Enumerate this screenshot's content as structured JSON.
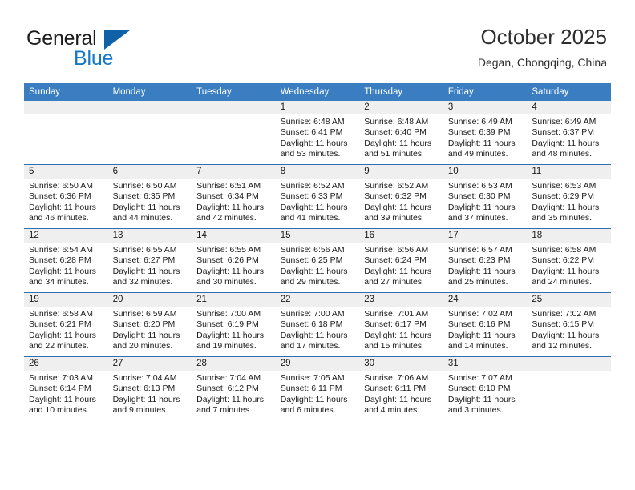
{
  "brand": {
    "line1": "General",
    "line2": "Blue",
    "triangle_color": "#1161a9",
    "blue_text_color": "#1678c8"
  },
  "header": {
    "title": "October 2025",
    "subtitle": "Degan, Chongqing, China"
  },
  "theme": {
    "header_row_bg": "#3a7dc0",
    "date_band_bg": "#efefef",
    "row_separator": "#2f6fb0",
    "text": "#1a1a1a"
  },
  "weekdays": [
    "Sunday",
    "Monday",
    "Tuesday",
    "Wednesday",
    "Thursday",
    "Friday",
    "Saturday"
  ],
  "weeks": [
    [
      {
        "blank": true
      },
      {
        "blank": true
      },
      {
        "blank": true
      },
      {
        "date": "1",
        "sunrise": "Sunrise: 6:48 AM",
        "sunset": "Sunset: 6:41 PM",
        "daylight1": "Daylight: 11 hours",
        "daylight2": "and 53 minutes."
      },
      {
        "date": "2",
        "sunrise": "Sunrise: 6:48 AM",
        "sunset": "Sunset: 6:40 PM",
        "daylight1": "Daylight: 11 hours",
        "daylight2": "and 51 minutes."
      },
      {
        "date": "3",
        "sunrise": "Sunrise: 6:49 AM",
        "sunset": "Sunset: 6:39 PM",
        "daylight1": "Daylight: 11 hours",
        "daylight2": "and 49 minutes."
      },
      {
        "date": "4",
        "sunrise": "Sunrise: 6:49 AM",
        "sunset": "Sunset: 6:37 PM",
        "daylight1": "Daylight: 11 hours",
        "daylight2": "and 48 minutes."
      }
    ],
    [
      {
        "date": "5",
        "sunrise": "Sunrise: 6:50 AM",
        "sunset": "Sunset: 6:36 PM",
        "daylight1": "Daylight: 11 hours",
        "daylight2": "and 46 minutes."
      },
      {
        "date": "6",
        "sunrise": "Sunrise: 6:50 AM",
        "sunset": "Sunset: 6:35 PM",
        "daylight1": "Daylight: 11 hours",
        "daylight2": "and 44 minutes."
      },
      {
        "date": "7",
        "sunrise": "Sunrise: 6:51 AM",
        "sunset": "Sunset: 6:34 PM",
        "daylight1": "Daylight: 11 hours",
        "daylight2": "and 42 minutes."
      },
      {
        "date": "8",
        "sunrise": "Sunrise: 6:52 AM",
        "sunset": "Sunset: 6:33 PM",
        "daylight1": "Daylight: 11 hours",
        "daylight2": "and 41 minutes."
      },
      {
        "date": "9",
        "sunrise": "Sunrise: 6:52 AM",
        "sunset": "Sunset: 6:32 PM",
        "daylight1": "Daylight: 11 hours",
        "daylight2": "and 39 minutes."
      },
      {
        "date": "10",
        "sunrise": "Sunrise: 6:53 AM",
        "sunset": "Sunset: 6:30 PM",
        "daylight1": "Daylight: 11 hours",
        "daylight2": "and 37 minutes."
      },
      {
        "date": "11",
        "sunrise": "Sunrise: 6:53 AM",
        "sunset": "Sunset: 6:29 PM",
        "daylight1": "Daylight: 11 hours",
        "daylight2": "and 35 minutes."
      }
    ],
    [
      {
        "date": "12",
        "sunrise": "Sunrise: 6:54 AM",
        "sunset": "Sunset: 6:28 PM",
        "daylight1": "Daylight: 11 hours",
        "daylight2": "and 34 minutes."
      },
      {
        "date": "13",
        "sunrise": "Sunrise: 6:55 AM",
        "sunset": "Sunset: 6:27 PM",
        "daylight1": "Daylight: 11 hours",
        "daylight2": "and 32 minutes."
      },
      {
        "date": "14",
        "sunrise": "Sunrise: 6:55 AM",
        "sunset": "Sunset: 6:26 PM",
        "daylight1": "Daylight: 11 hours",
        "daylight2": "and 30 minutes."
      },
      {
        "date": "15",
        "sunrise": "Sunrise: 6:56 AM",
        "sunset": "Sunset: 6:25 PM",
        "daylight1": "Daylight: 11 hours",
        "daylight2": "and 29 minutes."
      },
      {
        "date": "16",
        "sunrise": "Sunrise: 6:56 AM",
        "sunset": "Sunset: 6:24 PM",
        "daylight1": "Daylight: 11 hours",
        "daylight2": "and 27 minutes."
      },
      {
        "date": "17",
        "sunrise": "Sunrise: 6:57 AM",
        "sunset": "Sunset: 6:23 PM",
        "daylight1": "Daylight: 11 hours",
        "daylight2": "and 25 minutes."
      },
      {
        "date": "18",
        "sunrise": "Sunrise: 6:58 AM",
        "sunset": "Sunset: 6:22 PM",
        "daylight1": "Daylight: 11 hours",
        "daylight2": "and 24 minutes."
      }
    ],
    [
      {
        "date": "19",
        "sunrise": "Sunrise: 6:58 AM",
        "sunset": "Sunset: 6:21 PM",
        "daylight1": "Daylight: 11 hours",
        "daylight2": "and 22 minutes."
      },
      {
        "date": "20",
        "sunrise": "Sunrise: 6:59 AM",
        "sunset": "Sunset: 6:20 PM",
        "daylight1": "Daylight: 11 hours",
        "daylight2": "and 20 minutes."
      },
      {
        "date": "21",
        "sunrise": "Sunrise: 7:00 AM",
        "sunset": "Sunset: 6:19 PM",
        "daylight1": "Daylight: 11 hours",
        "daylight2": "and 19 minutes."
      },
      {
        "date": "22",
        "sunrise": "Sunrise: 7:00 AM",
        "sunset": "Sunset: 6:18 PM",
        "daylight1": "Daylight: 11 hours",
        "daylight2": "and 17 minutes."
      },
      {
        "date": "23",
        "sunrise": "Sunrise: 7:01 AM",
        "sunset": "Sunset: 6:17 PM",
        "daylight1": "Daylight: 11 hours",
        "daylight2": "and 15 minutes."
      },
      {
        "date": "24",
        "sunrise": "Sunrise: 7:02 AM",
        "sunset": "Sunset: 6:16 PM",
        "daylight1": "Daylight: 11 hours",
        "daylight2": "and 14 minutes."
      },
      {
        "date": "25",
        "sunrise": "Sunrise: 7:02 AM",
        "sunset": "Sunset: 6:15 PM",
        "daylight1": "Daylight: 11 hours",
        "daylight2": "and 12 minutes."
      }
    ],
    [
      {
        "date": "26",
        "sunrise": "Sunrise: 7:03 AM",
        "sunset": "Sunset: 6:14 PM",
        "daylight1": "Daylight: 11 hours",
        "daylight2": "and 10 minutes."
      },
      {
        "date": "27",
        "sunrise": "Sunrise: 7:04 AM",
        "sunset": "Sunset: 6:13 PM",
        "daylight1": "Daylight: 11 hours",
        "daylight2": "and 9 minutes."
      },
      {
        "date": "28",
        "sunrise": "Sunrise: 7:04 AM",
        "sunset": "Sunset: 6:12 PM",
        "daylight1": "Daylight: 11 hours",
        "daylight2": "and 7 minutes."
      },
      {
        "date": "29",
        "sunrise": "Sunrise: 7:05 AM",
        "sunset": "Sunset: 6:11 PM",
        "daylight1": "Daylight: 11 hours",
        "daylight2": "and 6 minutes."
      },
      {
        "date": "30",
        "sunrise": "Sunrise: 7:06 AM",
        "sunset": "Sunset: 6:11 PM",
        "daylight1": "Daylight: 11 hours",
        "daylight2": "and 4 minutes."
      },
      {
        "date": "31",
        "sunrise": "Sunrise: 7:07 AM",
        "sunset": "Sunset: 6:10 PM",
        "daylight1": "Daylight: 11 hours",
        "daylight2": "and 3 minutes."
      },
      {
        "blank": true
      }
    ]
  ]
}
